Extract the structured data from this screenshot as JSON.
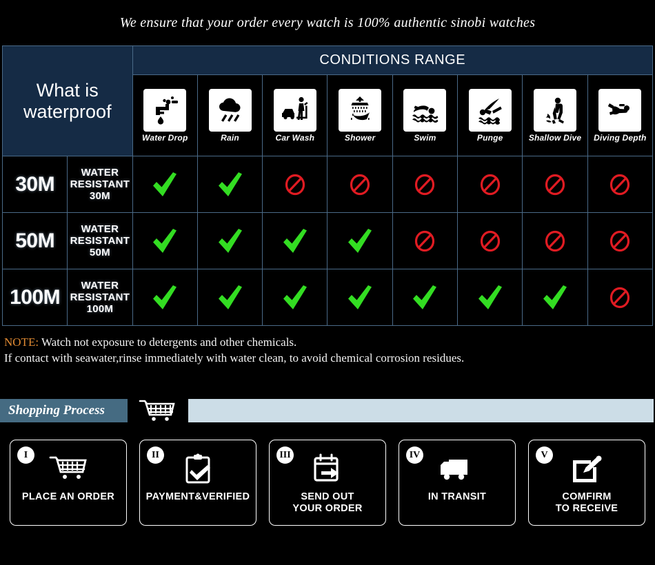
{
  "tagline": "We ensure that your order every watch is 100% authentic sinobi watches",
  "table": {
    "title": "What is waterproof",
    "range_header": "CONDITIONS RANGE",
    "conditions": [
      {
        "label": "Water Drop",
        "icon": "faucet-drip-icon"
      },
      {
        "label": "Rain",
        "icon": "rain-cloud-icon"
      },
      {
        "label": "Car Wash",
        "icon": "car-wash-icon"
      },
      {
        "label": "Shower",
        "icon": "shower-icon"
      },
      {
        "label": "Swim",
        "icon": "swimmer-icon"
      },
      {
        "label": "Punge",
        "icon": "plunge-dive-icon"
      },
      {
        "label": "Shallow\nDive",
        "icon": "shallow-diver-icon"
      },
      {
        "label": "Diving\nDepth",
        "icon": "scuba-diver-icon"
      }
    ],
    "rows": [
      {
        "depth": "30M",
        "description": "WATER RESISTANT  30M",
        "marks": [
          "check",
          "check",
          "ban",
          "ban",
          "ban",
          "ban",
          "ban",
          "ban"
        ]
      },
      {
        "depth": "50M",
        "description": "WATER RESISTANT 50M",
        "marks": [
          "check",
          "check",
          "check",
          "check",
          "ban",
          "ban",
          "ban",
          "ban"
        ]
      },
      {
        "depth": "100M",
        "description": "WATER RESISTANT  100M",
        "marks": [
          "check",
          "check",
          "check",
          "check",
          "check",
          "check",
          "check",
          "ban"
        ]
      }
    ]
  },
  "note": {
    "tag": "NOTE:",
    "line1": " Watch not exposure to detergents and other chemicals.",
    "line2": "If contact with seawater,rinse immediately with water clean, to avoid chemical corrosion residues."
  },
  "process": {
    "title": "Shopping Process",
    "cart_icon": "shopping-cart-icon",
    "steps": [
      {
        "numeral": "I",
        "label": "PLACE AN ORDER",
        "icon": "shopping-cart-icon"
      },
      {
        "numeral": "II",
        "label": "PAYMENT&VERIFIED",
        "icon": "clipboard-check-icon"
      },
      {
        "numeral": "III",
        "label": "SEND OUT\nYOUR ORDER",
        "icon": "calendar-arrow-icon"
      },
      {
        "numeral": "IV",
        "label": "IN TRANSIT",
        "icon": "delivery-truck-icon"
      },
      {
        "numeral": "V",
        "label": "COMFIRM\nTO RECEIVE",
        "icon": "note-pencil-icon"
      }
    ]
  },
  "colors": {
    "header_navy": "#152b45",
    "grid_line": "#4a6a88",
    "check_green": "#33dd22",
    "ban_red": "#e01b22",
    "note_tag_orange": "#e08a33",
    "process_bar_blue": "#456b82",
    "process_fill_blue": "#ccdde7"
  }
}
